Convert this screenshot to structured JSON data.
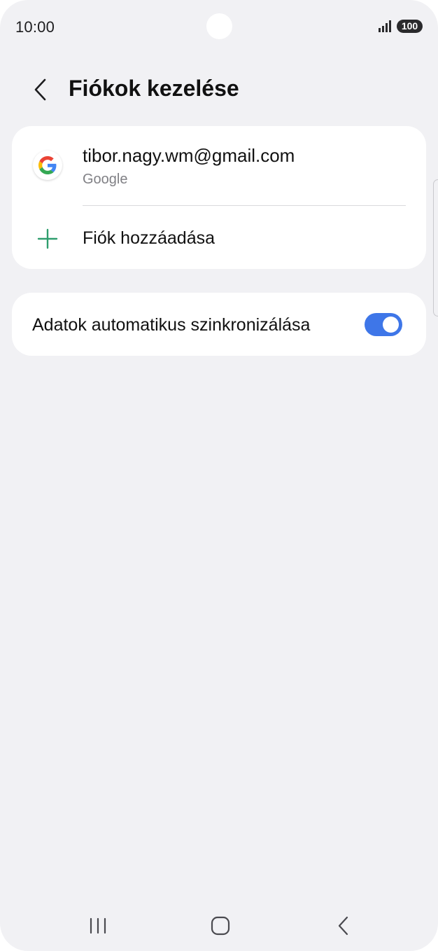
{
  "status_bar": {
    "time": "10:00",
    "battery": "100"
  },
  "header": {
    "title": "Fiókok kezelése"
  },
  "accounts": [
    {
      "email": "tibor.nagy.wm@gmail.com",
      "provider": "Google",
      "icon": "google-icon"
    }
  ],
  "add_account": {
    "label": "Fiók hozzáadása",
    "icon": "plus-icon"
  },
  "sync": {
    "label": "Adatok automatikus szinkronizálása",
    "enabled": true
  },
  "colors": {
    "background": "#f1f1f4",
    "card": "#ffffff",
    "accent": "#3e76e8",
    "plus": "#2f9e6e",
    "text": "#111111",
    "subtext": "#808085"
  },
  "nav_icons": [
    "recents-icon",
    "home-icon",
    "back-icon"
  ]
}
